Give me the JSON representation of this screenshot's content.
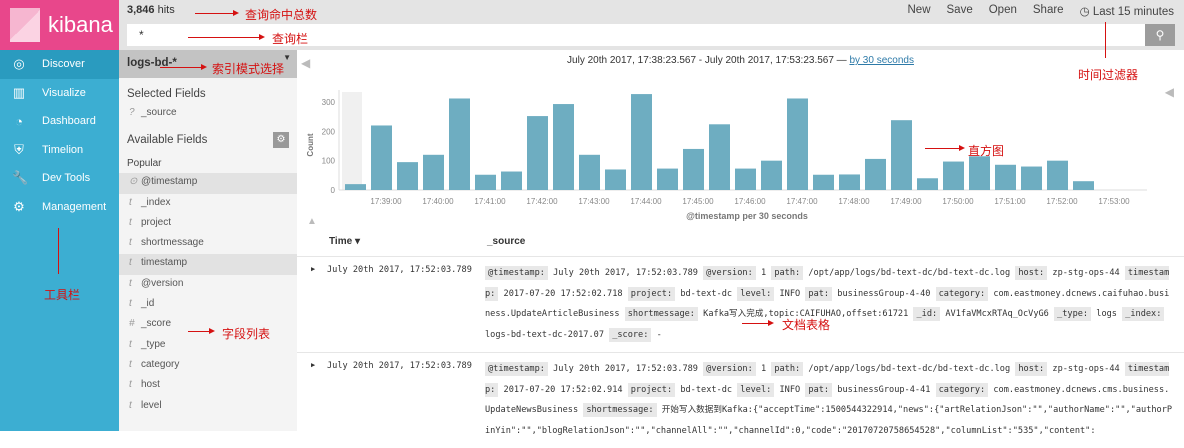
{
  "app": {
    "name": "kibana"
  },
  "nav": [
    {
      "label": "Discover",
      "icon": "compass-icon"
    },
    {
      "label": "Visualize",
      "icon": "bar-chart-icon"
    },
    {
      "label": "Dashboard",
      "icon": "dashboard-icon"
    },
    {
      "label": "Timelion",
      "icon": "shield-icon"
    },
    {
      "label": "Dev Tools",
      "icon": "wrench-icon"
    },
    {
      "label": "Management",
      "icon": "gear-icon"
    }
  ],
  "header": {
    "hits_count": "3,846",
    "hits_label": "hits",
    "menu": [
      "New",
      "Save",
      "Open",
      "Share"
    ],
    "time_filter": "Last 15 minutes",
    "query": "*"
  },
  "sidebar": {
    "index_pattern": "logs-bd-*",
    "selected_title": "Selected Fields",
    "selected": [
      "_source"
    ],
    "available_title": "Available Fields",
    "popular_title": "Popular",
    "fields": [
      {
        "t": "⊙",
        "n": "@timestamp"
      },
      {
        "t": "t",
        "n": "_index"
      },
      {
        "t": "t",
        "n": "project"
      },
      {
        "t": "t",
        "n": "shortmessage"
      },
      {
        "t": "t",
        "n": "timestamp"
      },
      {
        "t": "t",
        "n": "@version"
      },
      {
        "t": "t",
        "n": "_id"
      },
      {
        "t": "#",
        "n": "_score"
      },
      {
        "t": "t",
        "n": "_type"
      },
      {
        "t": "t",
        "n": "category"
      },
      {
        "t": "t",
        "n": "host"
      },
      {
        "t": "t",
        "n": "level"
      }
    ]
  },
  "histogram": {
    "range": "July 20th 2017, 17:38:23.567 - July 20th 2017, 17:53:23.567 —",
    "interval": "by 30 seconds"
  },
  "chart_data": {
    "type": "bar",
    "title": "",
    "xlabel": "@timestamp per 30 seconds",
    "ylabel": "Count",
    "ylim": [
      0,
      350
    ],
    "yticks": [
      0,
      100,
      200,
      300
    ],
    "xticks": [
      "17:39:00",
      "17:40:00",
      "17:41:00",
      "17:42:00",
      "17:43:00",
      "17:44:00",
      "17:45:00",
      "17:46:00",
      "17:47:00",
      "17:48:00",
      "17:49:00",
      "17:50:00",
      "17:51:00",
      "17:52:00",
      "17:53:00"
    ],
    "values": [
      20,
      220,
      95,
      120,
      312,
      52,
      63,
      252,
      293,
      120,
      70,
      327,
      73,
      140,
      224,
      73,
      100,
      312,
      52,
      53,
      106,
      238,
      40,
      97,
      115,
      86,
      80,
      100,
      30
    ]
  },
  "table": {
    "col_time": "Time",
    "col_source": "_source",
    "rows": [
      {
        "time": "July 20th 2017, 17:52:03.789",
        "fields": [
          [
            "@timestamp:",
            "July 20th 2017, 17:52:03.789"
          ],
          [
            "@version:",
            "1"
          ],
          [
            "path:",
            "/opt/app/logs/bd-text-dc/bd-text-dc.log"
          ],
          [
            "host:",
            "zp-stg-ops-44"
          ],
          [
            "timestamp:",
            "2017-07-20 17:52:02.718"
          ],
          [
            "project:",
            "bd-text-dc"
          ],
          [
            "level:",
            "INFO"
          ],
          [
            "pat:",
            "businessGroup-4-40"
          ],
          [
            "category:",
            "com.eastmoney.dcnews.caifuhao.business.UpdateArticleBusiness"
          ],
          [
            "shortmessage:",
            "Kafka写入完成,topic:CAIFUHAO,offset:61721"
          ],
          [
            "_id:",
            "AV1faVMcxRTAq_OcVyG6"
          ],
          [
            "_type:",
            "logs"
          ],
          [
            "_index:",
            "logs-bd-text-dc-2017.07"
          ],
          [
            "_score:",
            "-"
          ]
        ]
      },
      {
        "time": "July 20th 2017, 17:52:03.789",
        "fields": [
          [
            "@timestamp:",
            "July 20th 2017, 17:52:03.789"
          ],
          [
            "@version:",
            "1"
          ],
          [
            "path:",
            "/opt/app/logs/bd-text-dc/bd-text-dc.log"
          ],
          [
            "host:",
            "zp-stg-ops-44"
          ],
          [
            "timestamp:",
            "2017-07-20 17:52:02.914"
          ],
          [
            "project:",
            "bd-text-dc"
          ],
          [
            "level:",
            "INFO"
          ],
          [
            "pat:",
            "businessGroup-4-41"
          ],
          [
            "category:",
            "com.eastmoney.dcnews.cms.business.UpdateNewsBusiness"
          ],
          [
            "shortmessage:",
            "开始写入数据到Kafka:{\"acceptTime\":1500544322914,\"news\":{\"artRelationJson\":\"\",\"authorName\":\"\",\"authorPinYin\":\"\",\"blogRelationJson\":\"\",\"channelAll\":\"\",\"channelId\":0,\"code\":\"20170720758654528\",\"columnList\":\"535\",\"content\":"
          ]
        ]
      }
    ]
  },
  "annotations": {
    "hits": "查询命中总数",
    "query": "查询栏",
    "index": "索引模式选择",
    "time": "时间过滤器",
    "histogram": "直方图",
    "toolbar": "工具栏",
    "fields": "字段列表",
    "docs": "文档表格"
  },
  "colors": {
    "bar": "#6eadc1",
    "nav": "#3caed2",
    "logo": "#e8478b"
  }
}
